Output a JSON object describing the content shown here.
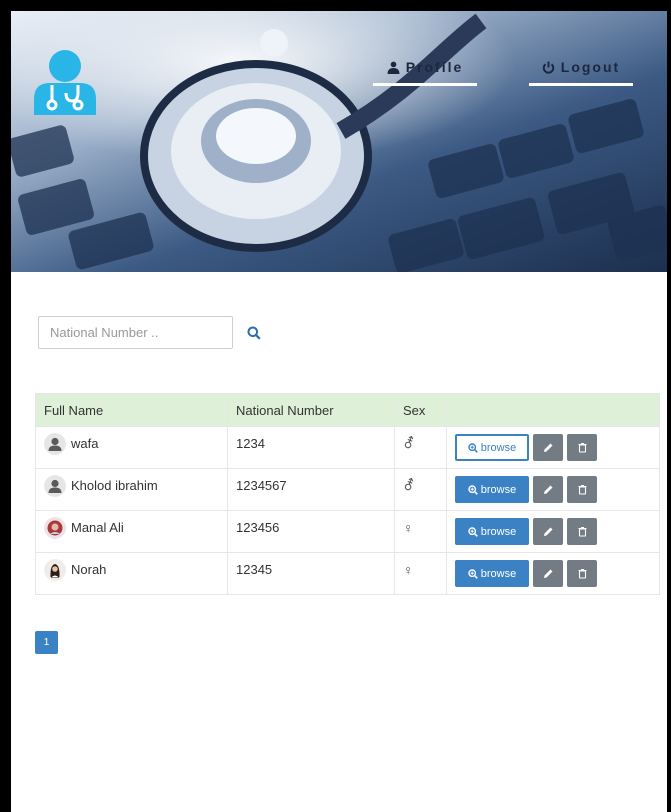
{
  "nav": {
    "profile_label": "Profile",
    "logout_label": "Logout"
  },
  "search": {
    "placeholder": "National Number .."
  },
  "table": {
    "headers": [
      "Full Name",
      "National Number",
      "Sex",
      ""
    ],
    "rows": [
      {
        "name": "wafa",
        "national_number": "1234",
        "sex": "⚦",
        "avatar": "default-avatar-icon",
        "browse_style": "outline"
      },
      {
        "name": "Kholod ibrahim",
        "national_number": "1234567",
        "sex": "⚦",
        "avatar": "default-avatar-icon",
        "browse_style": "filled"
      },
      {
        "name": "Manal Ali",
        "national_number": "123456",
        "sex": "♀",
        "avatar": "photo-avatar",
        "browse_style": "filled"
      },
      {
        "name": "Norah",
        "national_number": "12345",
        "sex": "♀",
        "avatar": "female-avatar-icon",
        "browse_style": "filled"
      }
    ],
    "browse_label": "browse"
  },
  "pagination": {
    "current_page": "1"
  },
  "colors": {
    "accent": "#3b82c4",
    "header_bg": "#dff0d8",
    "logo": "#29b6e6",
    "action_gray": "#737b84"
  }
}
